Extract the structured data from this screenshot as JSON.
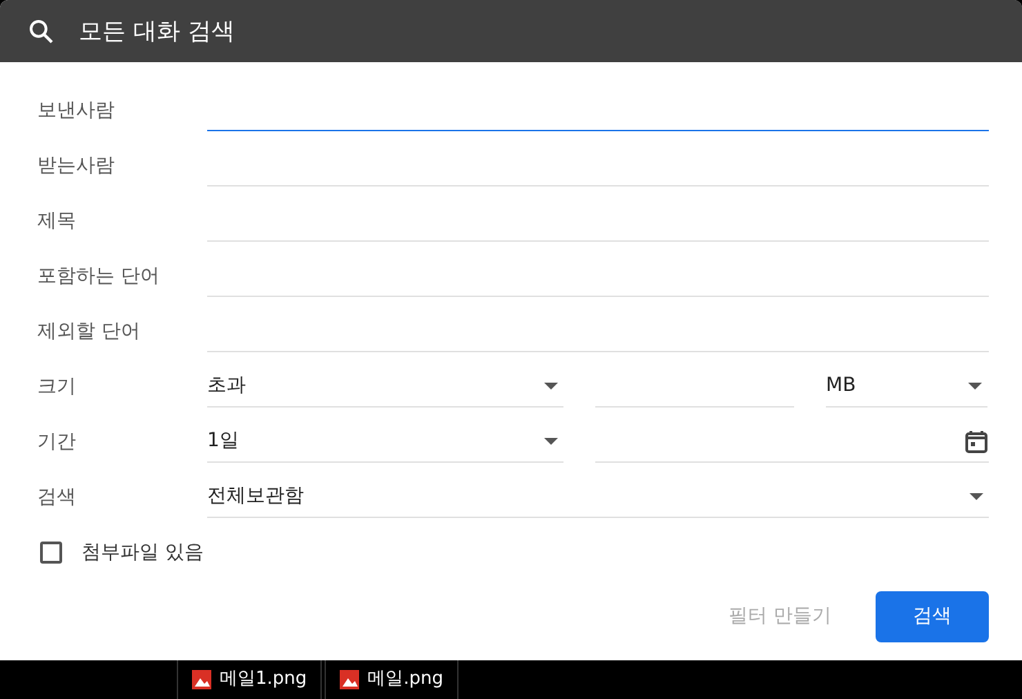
{
  "search_bar": {
    "placeholder": "모든 대화 검색"
  },
  "rows": [
    {
      "kind": "text",
      "label": "보낸사람",
      "focused": true
    },
    {
      "kind": "text",
      "label": "받는사람",
      "focused": false
    },
    {
      "kind": "text",
      "label": "제목",
      "focused": false
    },
    {
      "kind": "text",
      "label": "포함하는 단어",
      "focused": false
    },
    {
      "kind": "text",
      "label": "제외할 단어",
      "focused": false
    },
    {
      "kind": "size",
      "label": "크기",
      "operator": "초과",
      "unit": "MB"
    },
    {
      "kind": "date",
      "label": "기간",
      "range": "1일"
    },
    {
      "kind": "select",
      "label": "검색",
      "value": "전체보관함"
    }
  ],
  "attachment": {
    "label": "첨부파일 있음",
    "checked": false
  },
  "buttons": [
    {
      "kind": "text",
      "label": "필터 만들기",
      "disabled": true
    },
    {
      "kind": "primary",
      "label": "검색",
      "disabled": false
    }
  ],
  "attachments_bar": [
    {
      "name": "메일1.png"
    },
    {
      "name": "메일.png"
    }
  ]
}
